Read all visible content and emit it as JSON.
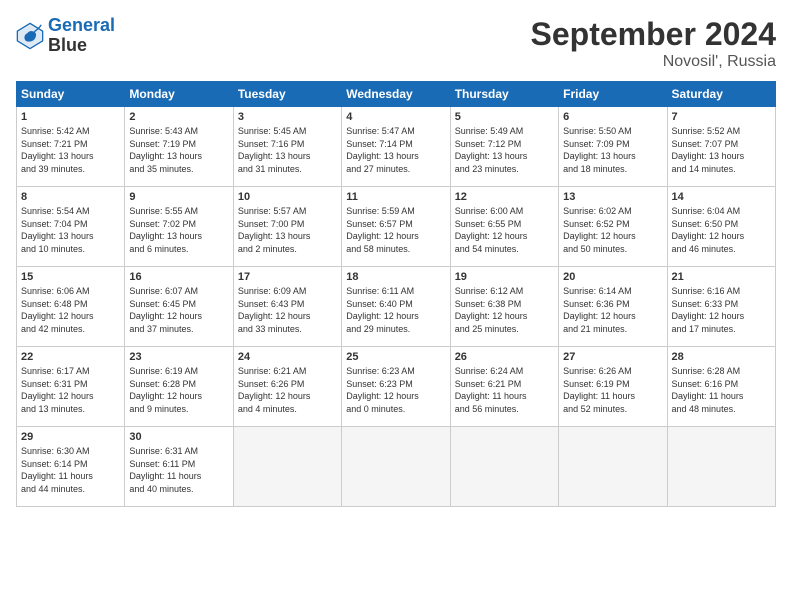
{
  "logo": {
    "line1": "General",
    "line2": "Blue"
  },
  "title": "September 2024",
  "location": "Novosil', Russia",
  "days_header": [
    "Sunday",
    "Monday",
    "Tuesday",
    "Wednesday",
    "Thursday",
    "Friday",
    "Saturday"
  ],
  "weeks": [
    [
      {
        "num": "1",
        "info": "Sunrise: 5:42 AM\nSunset: 7:21 PM\nDaylight: 13 hours\nand 39 minutes."
      },
      {
        "num": "2",
        "info": "Sunrise: 5:43 AM\nSunset: 7:19 PM\nDaylight: 13 hours\nand 35 minutes."
      },
      {
        "num": "3",
        "info": "Sunrise: 5:45 AM\nSunset: 7:16 PM\nDaylight: 13 hours\nand 31 minutes."
      },
      {
        "num": "4",
        "info": "Sunrise: 5:47 AM\nSunset: 7:14 PM\nDaylight: 13 hours\nand 27 minutes."
      },
      {
        "num": "5",
        "info": "Sunrise: 5:49 AM\nSunset: 7:12 PM\nDaylight: 13 hours\nand 23 minutes."
      },
      {
        "num": "6",
        "info": "Sunrise: 5:50 AM\nSunset: 7:09 PM\nDaylight: 13 hours\nand 18 minutes."
      },
      {
        "num": "7",
        "info": "Sunrise: 5:52 AM\nSunset: 7:07 PM\nDaylight: 13 hours\nand 14 minutes."
      }
    ],
    [
      {
        "num": "8",
        "info": "Sunrise: 5:54 AM\nSunset: 7:04 PM\nDaylight: 13 hours\nand 10 minutes."
      },
      {
        "num": "9",
        "info": "Sunrise: 5:55 AM\nSunset: 7:02 PM\nDaylight: 13 hours\nand 6 minutes."
      },
      {
        "num": "10",
        "info": "Sunrise: 5:57 AM\nSunset: 7:00 PM\nDaylight: 13 hours\nand 2 minutes."
      },
      {
        "num": "11",
        "info": "Sunrise: 5:59 AM\nSunset: 6:57 PM\nDaylight: 12 hours\nand 58 minutes."
      },
      {
        "num": "12",
        "info": "Sunrise: 6:00 AM\nSunset: 6:55 PM\nDaylight: 12 hours\nand 54 minutes."
      },
      {
        "num": "13",
        "info": "Sunrise: 6:02 AM\nSunset: 6:52 PM\nDaylight: 12 hours\nand 50 minutes."
      },
      {
        "num": "14",
        "info": "Sunrise: 6:04 AM\nSunset: 6:50 PM\nDaylight: 12 hours\nand 46 minutes."
      }
    ],
    [
      {
        "num": "15",
        "info": "Sunrise: 6:06 AM\nSunset: 6:48 PM\nDaylight: 12 hours\nand 42 minutes."
      },
      {
        "num": "16",
        "info": "Sunrise: 6:07 AM\nSunset: 6:45 PM\nDaylight: 12 hours\nand 37 minutes."
      },
      {
        "num": "17",
        "info": "Sunrise: 6:09 AM\nSunset: 6:43 PM\nDaylight: 12 hours\nand 33 minutes."
      },
      {
        "num": "18",
        "info": "Sunrise: 6:11 AM\nSunset: 6:40 PM\nDaylight: 12 hours\nand 29 minutes."
      },
      {
        "num": "19",
        "info": "Sunrise: 6:12 AM\nSunset: 6:38 PM\nDaylight: 12 hours\nand 25 minutes."
      },
      {
        "num": "20",
        "info": "Sunrise: 6:14 AM\nSunset: 6:36 PM\nDaylight: 12 hours\nand 21 minutes."
      },
      {
        "num": "21",
        "info": "Sunrise: 6:16 AM\nSunset: 6:33 PM\nDaylight: 12 hours\nand 17 minutes."
      }
    ],
    [
      {
        "num": "22",
        "info": "Sunrise: 6:17 AM\nSunset: 6:31 PM\nDaylight: 12 hours\nand 13 minutes."
      },
      {
        "num": "23",
        "info": "Sunrise: 6:19 AM\nSunset: 6:28 PM\nDaylight: 12 hours\nand 9 minutes."
      },
      {
        "num": "24",
        "info": "Sunrise: 6:21 AM\nSunset: 6:26 PM\nDaylight: 12 hours\nand 4 minutes."
      },
      {
        "num": "25",
        "info": "Sunrise: 6:23 AM\nSunset: 6:23 PM\nDaylight: 12 hours\nand 0 minutes."
      },
      {
        "num": "26",
        "info": "Sunrise: 6:24 AM\nSunset: 6:21 PM\nDaylight: 11 hours\nand 56 minutes."
      },
      {
        "num": "27",
        "info": "Sunrise: 6:26 AM\nSunset: 6:19 PM\nDaylight: 11 hours\nand 52 minutes."
      },
      {
        "num": "28",
        "info": "Sunrise: 6:28 AM\nSunset: 6:16 PM\nDaylight: 11 hours\nand 48 minutes."
      }
    ],
    [
      {
        "num": "29",
        "info": "Sunrise: 6:30 AM\nSunset: 6:14 PM\nDaylight: 11 hours\nand 44 minutes."
      },
      {
        "num": "30",
        "info": "Sunrise: 6:31 AM\nSunset: 6:11 PM\nDaylight: 11 hours\nand 40 minutes."
      },
      {
        "num": "",
        "info": ""
      },
      {
        "num": "",
        "info": ""
      },
      {
        "num": "",
        "info": ""
      },
      {
        "num": "",
        "info": ""
      },
      {
        "num": "",
        "info": ""
      }
    ]
  ]
}
